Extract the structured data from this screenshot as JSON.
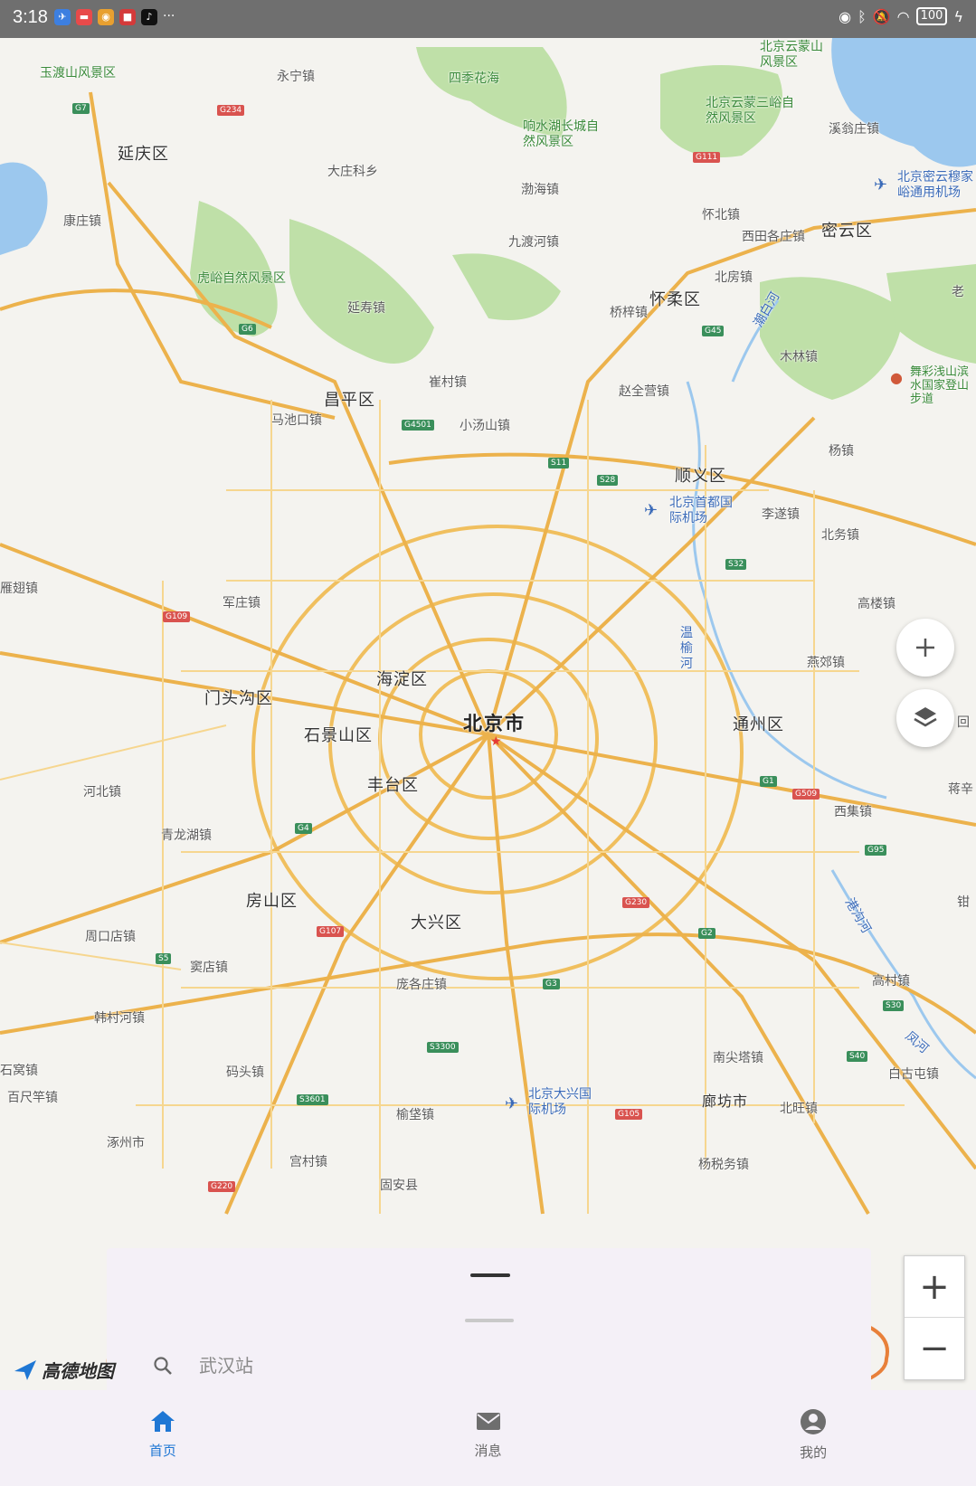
{
  "status_bar": {
    "time": "3:18",
    "more": "···",
    "battery": "100"
  },
  "map": {
    "city_label": "北京市",
    "districts": [
      "延庆区",
      "昌平区",
      "怀柔区",
      "密云区",
      "顺义区",
      "海淀区",
      "门头沟区",
      "石景山区",
      "丰台区",
      "通州区",
      "房山区",
      "大兴区"
    ],
    "towns": [
      "永宁镇",
      "大庄科乡",
      "康庄镇",
      "渤海镇",
      "怀北镇",
      "九渡河镇",
      "西田各庄镇",
      "北房镇",
      "桥梓镇",
      "延寿镇",
      "崔村镇",
      "木林镇",
      "赵全营镇",
      "马池口镇",
      "小汤山镇",
      "杨镇",
      "李遂镇",
      "北务镇",
      "军庄镇",
      "高楼镇",
      "燕郊镇",
      "河北镇",
      "西集镇",
      "青龙湖镇",
      "周口店镇",
      "窦店镇",
      "庞各庄镇",
      "高村镇",
      "韩村河镇",
      "南尖塔镇",
      "码头镇",
      "百尺竿镇",
      "白古屯镇",
      "北旺镇",
      "廊坊市",
      "榆垡镇",
      "涿州市",
      "宫村镇",
      "杨税务镇",
      "溪翁庄镇",
      "雁翅镇",
      "老",
      "舞彩浅山滨水国家登山步道",
      "回",
      "蒋辛",
      "钳",
      "石窝镇",
      "固安县"
    ],
    "scenic": [
      "玉渡山风景区",
      "四季花海",
      "响水湖长城自然风景区",
      "北京云蒙山风景区",
      "北京云蒙三峪自然风景区",
      "虎峪自然风景区"
    ],
    "airports": [
      "北京首都国际机场",
      "北京大兴国际机场",
      "北京密云穆家峪通用机场"
    ],
    "rivers": [
      "温榆河",
      "潮白河",
      "港沟河",
      "凤河"
    ],
    "road_shields": [
      "G7",
      "G234",
      "G111",
      "G6",
      "G45",
      "G4501",
      "S11",
      "S28",
      "S32",
      "G109",
      "G1",
      "G509",
      "G95",
      "G4",
      "G230",
      "G2",
      "G3",
      "G107",
      "S5",
      "S3300",
      "S3601",
      "S30",
      "S40",
      "G105",
      "G220"
    ]
  },
  "controls": {
    "zoom_in": "+",
    "zoom_out": "−",
    "add_icon": "plus-icon",
    "layers_icon": "layers-icon"
  },
  "sheet": {
    "search_placeholder": "武汉站"
  },
  "logo": "高德地图",
  "nav": {
    "items": [
      {
        "label": "首页",
        "icon": "home-icon",
        "active": true
      },
      {
        "label": "消息",
        "icon": "mail-icon",
        "active": false
      },
      {
        "label": "我的",
        "icon": "user-icon",
        "active": false
      }
    ]
  },
  "colors": {
    "accent": "#1f77d4",
    "annotation": "#e8803a",
    "road": "#f2c46a",
    "park": "#b8dca0",
    "water": "#9cc8ee"
  }
}
